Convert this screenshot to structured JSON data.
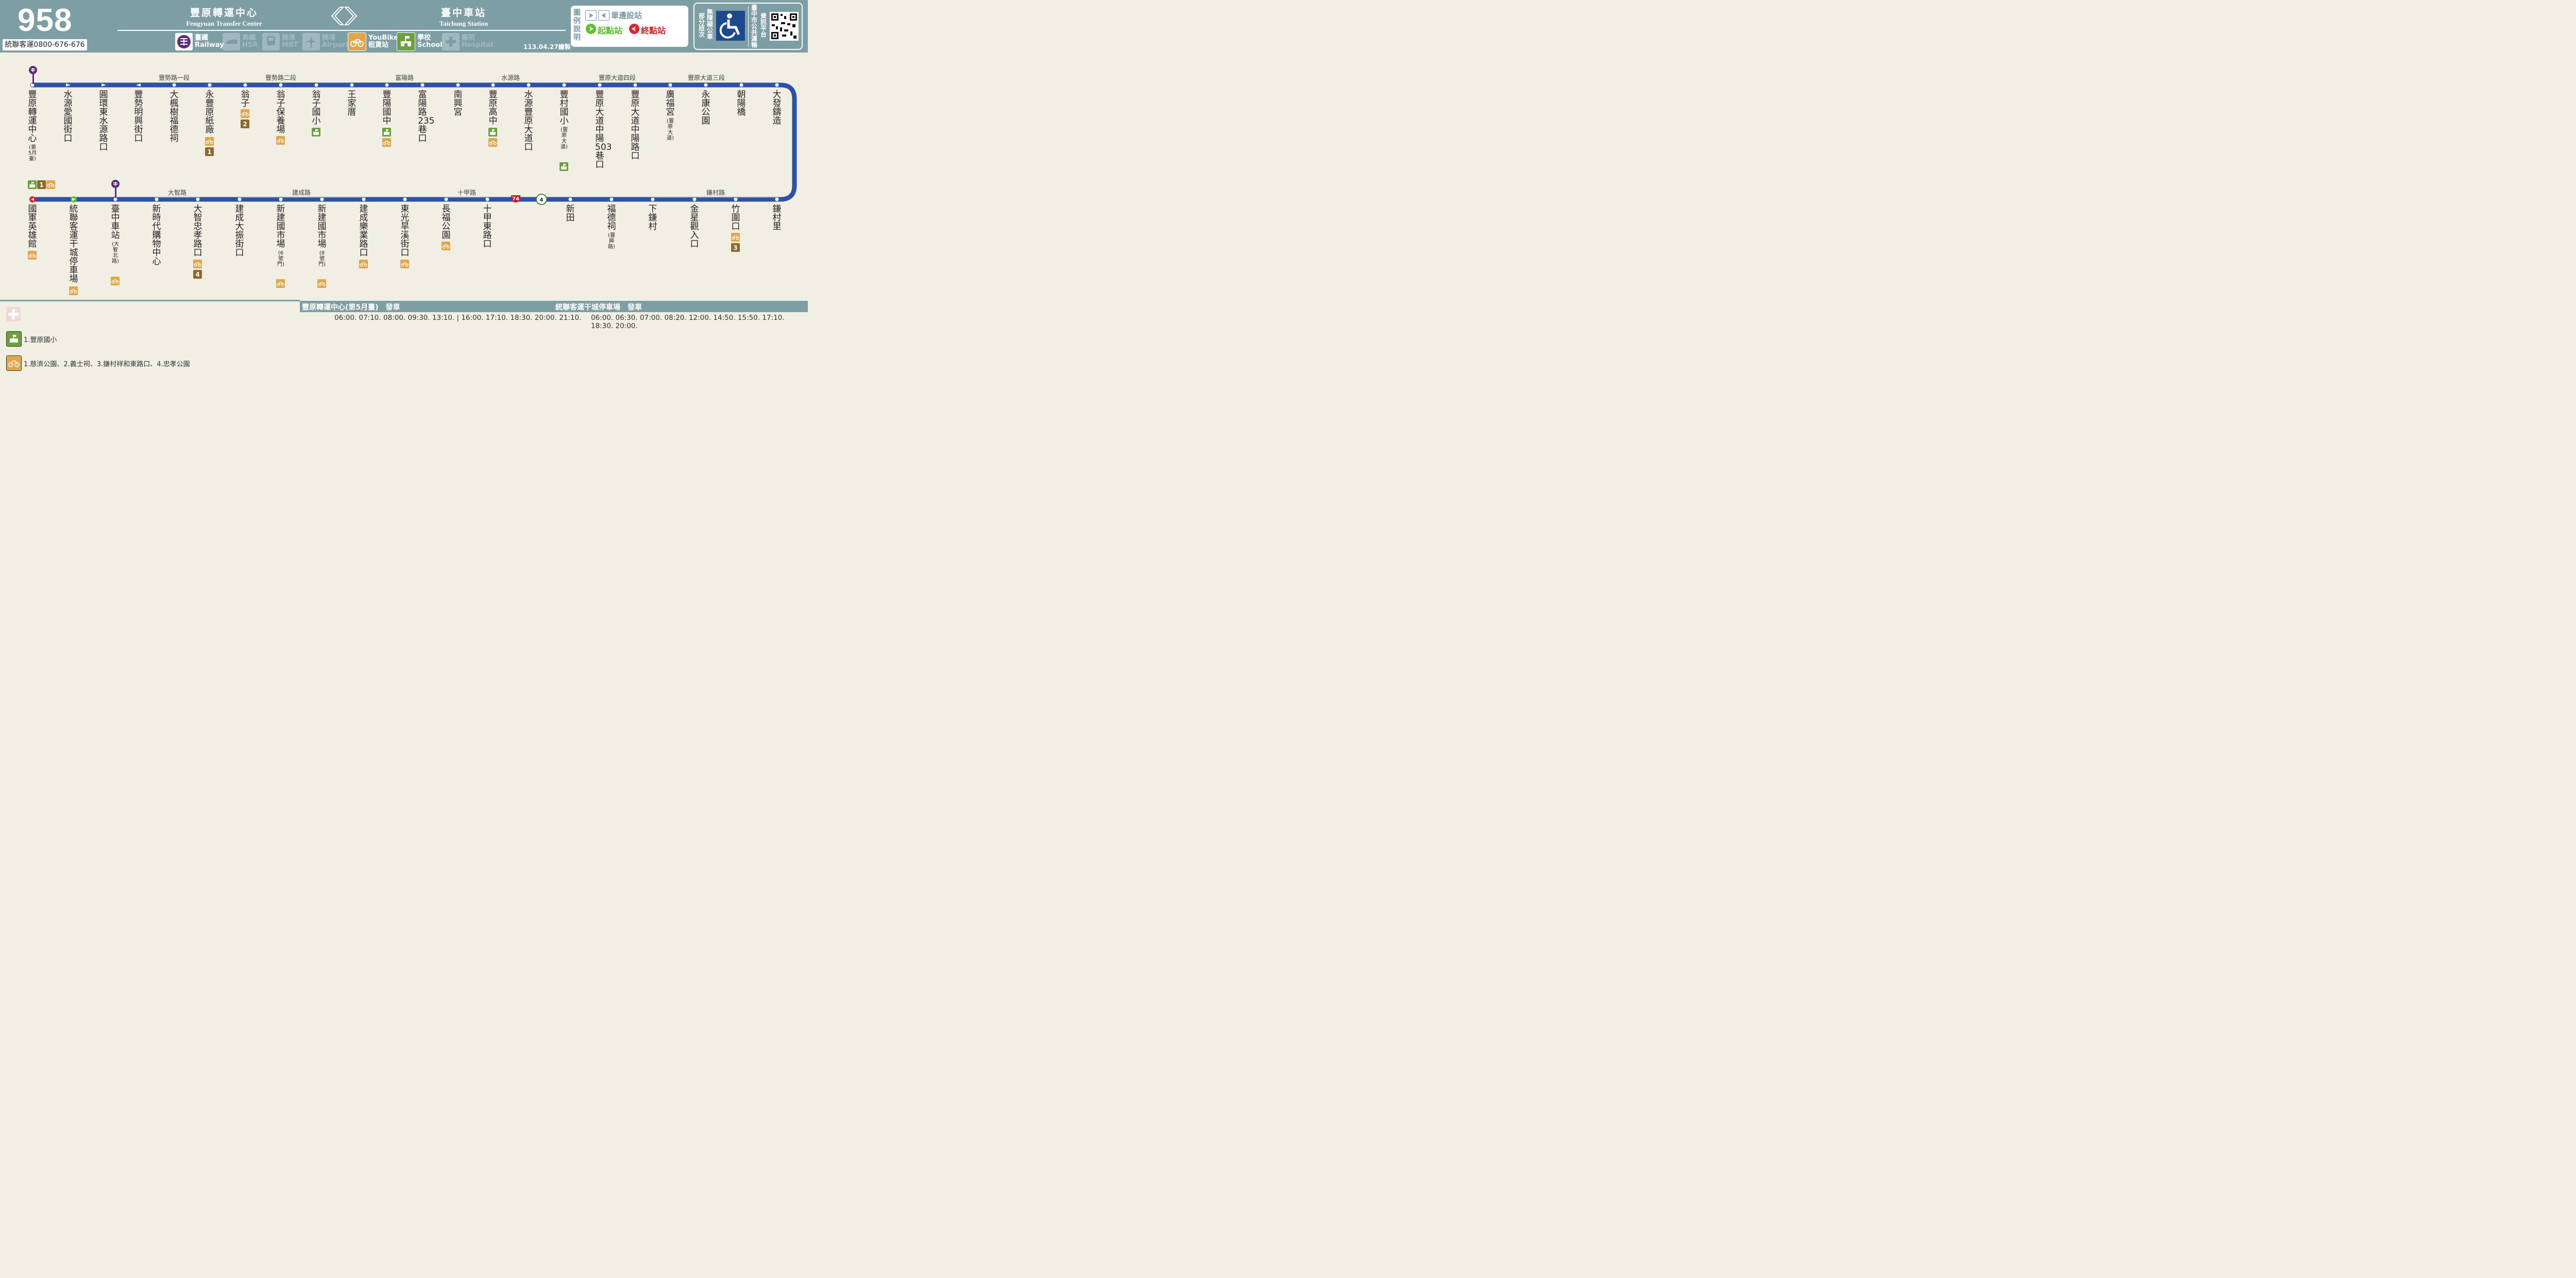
{
  "header": {
    "route_number": "958",
    "phone": "統聯客運0800-676-676",
    "origin_zh": "豐原轉運中心",
    "origin_en": "Fengyuan Transfer Center",
    "dest_zh": "臺中車站",
    "dest_en": "Taichung Station",
    "date": "113.04.27繪製",
    "facilities": [
      {
        "zh": "臺鐵",
        "en": "Railway",
        "active": true,
        "icon": "railway-icon"
      },
      {
        "zh": "高鐵",
        "en": "HSR",
        "active": false,
        "icon": "hsr-icon"
      },
      {
        "zh": "捷運",
        "en": "MRT",
        "active": false,
        "icon": "mrt-icon"
      },
      {
        "zh": "機場",
        "en": "Airport",
        "active": false,
        "icon": "airport-icon"
      },
      {
        "zh": "YouBike",
        "en": "租賃站",
        "active": true,
        "icon": "youbike-icon"
      },
      {
        "zh": "學校",
        "en": "School",
        "active": true,
        "icon": "school-icon"
      },
      {
        "zh": "醫院",
        "en": "Hospital",
        "active": false,
        "icon": "hospital-icon"
      }
    ]
  },
  "legend": {
    "title": "圖例說明",
    "one_way": "單邊設站",
    "start": "起點站",
    "end": "終點站"
  },
  "accessibility": {
    "line1": "部分班次",
    "line2": "無障礙公車",
    "line3": "臺中市公共運輸",
    "line4": "資訊平台"
  },
  "colors": {
    "header": "#7d9ea5",
    "route_line": "#2c52a8",
    "background": "#f1eee4",
    "bike": "#e2a54a",
    "school": "#6aa13b"
  },
  "roads_top": [
    "豐勢路一段",
    "豐勢路二段",
    "富陽路",
    "水源路",
    "豐原大道四段",
    "豐原大道三段"
  ],
  "roads_bottom": [
    "大智路",
    "建成路",
    "十甲路",
    "鎌村路"
  ],
  "route_markers": {
    "provincial": "74",
    "county": "4"
  },
  "stops_top": [
    {
      "name": "豐原轉運中心",
      "note": "(第5月臺)"
    },
    {
      "name": "水源愛國街口",
      "note": ""
    },
    {
      "name": "圓環東水源路口",
      "note": ""
    },
    {
      "name": "豐勢明興街口",
      "note": ""
    },
    {
      "name": "大楓樹福德祠",
      "note": ""
    },
    {
      "name": "永豐原紙廠",
      "note": ""
    },
    {
      "name": "翁子",
      "note": ""
    },
    {
      "name": "翁子保養場",
      "note": ""
    },
    {
      "name": "翁子國小",
      "note": ""
    },
    {
      "name": "王家厝",
      "note": ""
    },
    {
      "name": "豐陽國中",
      "note": ""
    },
    {
      "name": "富陽路235巷口",
      "note": ""
    },
    {
      "name": "南興宮",
      "note": ""
    },
    {
      "name": "豐原高中",
      "note": ""
    },
    {
      "name": "水源豐原大道口",
      "note": ""
    },
    {
      "name": "豐村國小",
      "note": "(豐原大道)"
    },
    {
      "name": "豐原大道中陽503巷口",
      "note": ""
    },
    {
      "name": "豐原大道中陽路口",
      "note": ""
    },
    {
      "name": "廣福宮",
      "note": "(豐原大道)"
    },
    {
      "name": "永康公園",
      "note": ""
    },
    {
      "name": "朝陽橋",
      "note": ""
    },
    {
      "name": "大發鑄造",
      "note": ""
    }
  ],
  "stops_bottom": [
    {
      "name": "國軍英雄館",
      "note": ""
    },
    {
      "name": "統聯客運干城停車場",
      "note": ""
    },
    {
      "name": "臺中車站",
      "note": "(大智北路)"
    },
    {
      "name": "新時代購物中心",
      "note": ""
    },
    {
      "name": "大智忠孝路口",
      "note": ""
    },
    {
      "name": "建成大振街口",
      "note": ""
    },
    {
      "name": "新建國市場",
      "note": "(6號門)"
    },
    {
      "name": "新建國市場",
      "note": "(8號門)"
    },
    {
      "name": "建成樂業路口",
      "note": ""
    },
    {
      "name": "東光旱溪街口",
      "note": ""
    },
    {
      "name": "長福公園",
      "note": ""
    },
    {
      "name": "十甲東路口",
      "note": ""
    },
    {
      "name": "新田",
      "note": ""
    },
    {
      "name": "福德祠",
      "note": "(豐興路)"
    },
    {
      "name": "下鎌村",
      "note": ""
    },
    {
      "name": "金星觀入口",
      "note": ""
    },
    {
      "name": "竹圍口",
      "note": ""
    },
    {
      "name": "鎌村里",
      "note": ""
    }
  ],
  "badges": {
    "n1": "1",
    "n2": "2",
    "n3": "3",
    "n4": "4"
  },
  "schedule": {
    "a_title": "豐原轉運中心(第5月臺)　發車",
    "a_times": "06:00. 07:10. 08:00. 09:30. 13:10. | 16:00. 17:10. 18:30. 20:00. 21:10.",
    "b_title": "統聯客運干城停車場　發車",
    "b_times": "06:00. 06:30. 07:00. 08:20. 12:00. 14:50. 15:50. 17:10. 18:30. 20:00."
  },
  "footnotes": {
    "school": "1.豐原國小",
    "bike": "1.慈濟公園、2.義士祠、3.鎌村祥和東路口、4.忠孝公園"
  }
}
